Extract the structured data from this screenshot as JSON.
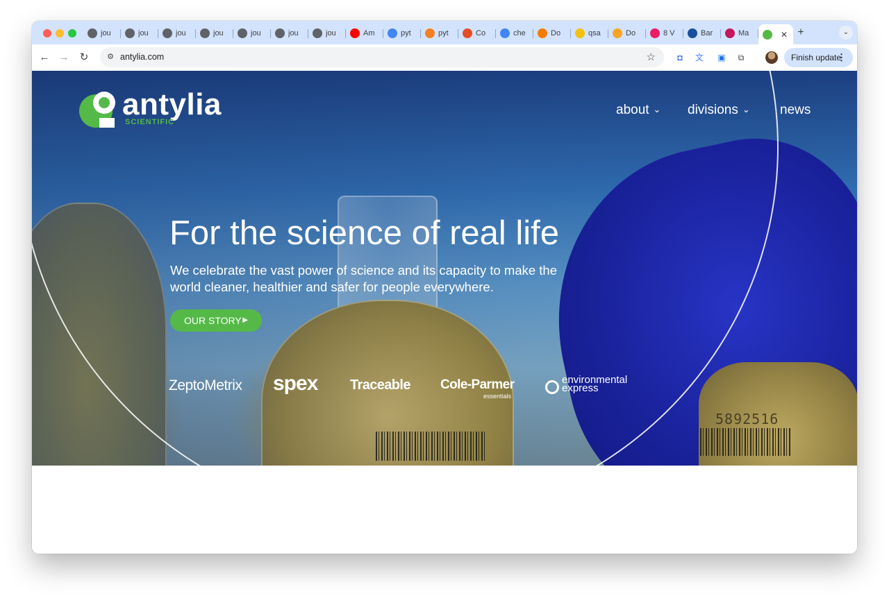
{
  "browser": {
    "tabs": [
      {
        "title": "jou",
        "icon": "openai-icon",
        "color": "#5f6368"
      },
      {
        "title": "jou",
        "icon": "openai-icon",
        "color": "#5f6368"
      },
      {
        "title": "jou",
        "icon": "openai-icon",
        "color": "#5f6368"
      },
      {
        "title": "jou",
        "icon": "openai-icon",
        "color": "#5f6368"
      },
      {
        "title": "jou",
        "icon": "globe-icon",
        "color": "#5f6368"
      },
      {
        "title": "jou",
        "icon": "globe-icon",
        "color": "#5f6368"
      },
      {
        "title": "jou",
        "icon": "globe-icon",
        "color": "#5f6368"
      },
      {
        "title": "Am",
        "icon": "youtube-icon",
        "color": "#ff0000"
      },
      {
        "title": "pyt",
        "icon": "google-icon",
        "color": "#4285f4"
      },
      {
        "title": "pyt",
        "icon": "stackoverflow-icon",
        "color": "#f48024"
      },
      {
        "title": "Co",
        "icon": "joomla-icon",
        "color": "#e44d26"
      },
      {
        "title": "che",
        "icon": "google-icon",
        "color": "#4285f4"
      },
      {
        "title": "Do",
        "icon": "orange-circle-icon",
        "color": "#f57c00"
      },
      {
        "title": "qsa",
        "icon": "yellow-square-icon",
        "color": "#f4c20d"
      },
      {
        "title": "Do",
        "icon": "orange-x-icon",
        "color": "#f6a623"
      },
      {
        "title": "8 V",
        "icon": "red-circle-icon",
        "color": "#e91e63"
      },
      {
        "title": "Bar",
        "icon": "chart-icon",
        "color": "#1a4fa0"
      },
      {
        "title": "Ma",
        "icon": "flag-icon",
        "color": "#c2185b"
      }
    ],
    "active_tab": {
      "icon": "antylia-icon",
      "color": "#55b948",
      "close": "✕"
    },
    "new_tab": "+",
    "tab_menu": "⌄",
    "url": "antylia.com",
    "finish_update": "Finish update"
  },
  "site": {
    "logo": {
      "word": "antylia",
      "sub": "SCIENTIFIC",
      "accent": "#55b948"
    },
    "nav": [
      {
        "label": "about",
        "chevron": "⌄"
      },
      {
        "label": "divisions",
        "chevron": "⌄"
      },
      {
        "label": "news",
        "chevron": ""
      }
    ],
    "headline": "For the science of real life",
    "subtext": "We celebrate the vast power of science and its capacity to make the world cleaner, healthier and safer for people everywhere.",
    "cta": "OUR STORY",
    "brands": {
      "zeptometrix": "ZeptoMetrix",
      "spex": "spex",
      "traceable": "Traceable",
      "coleparmer": "Cole-Parmer",
      "coleparmer_sub": "essentials",
      "envexpress_line1": "environmental",
      "envexpress_line2": "express"
    },
    "barcode_number": "5892516"
  }
}
